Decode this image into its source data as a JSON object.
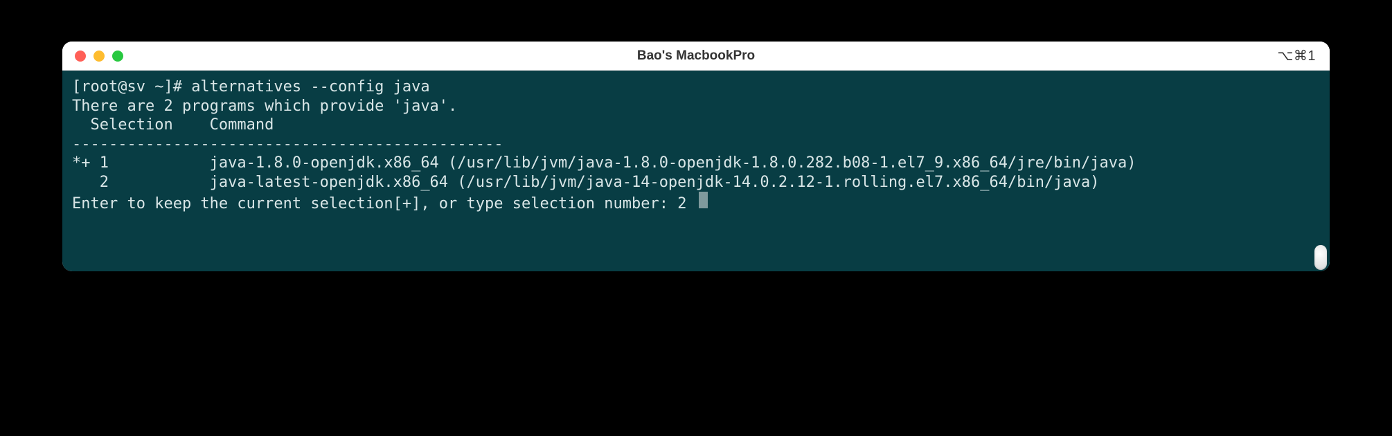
{
  "window": {
    "title": "Bao's MacbookPro",
    "shortcut_indicator": "⌥⌘1"
  },
  "terminal": {
    "prompt": "[root@sv ~]# ",
    "command": "alternatives --config java",
    "blank1": "",
    "line_intro": "There are 2 programs which provide 'java'.",
    "blank2": "",
    "header": "  Selection    Command",
    "divider": "-----------------------------------------------",
    "row1": "*+ 1           java-1.8.0-openjdk.x86_64 (/usr/lib/jvm/java-1.8.0-openjdk-1.8.0.282.b08-1.el7_9.x86_64/jre/bin/java)",
    "row2": "   2           java-latest-openjdk.x86_64 (/usr/lib/jvm/java-14-openjdk-14.0.2.12-1.rolling.el7.x86_64/bin/java)",
    "blank3": "",
    "prompt2": "Enter to keep the current selection[+], or type selection number: ",
    "input_value": "2"
  }
}
